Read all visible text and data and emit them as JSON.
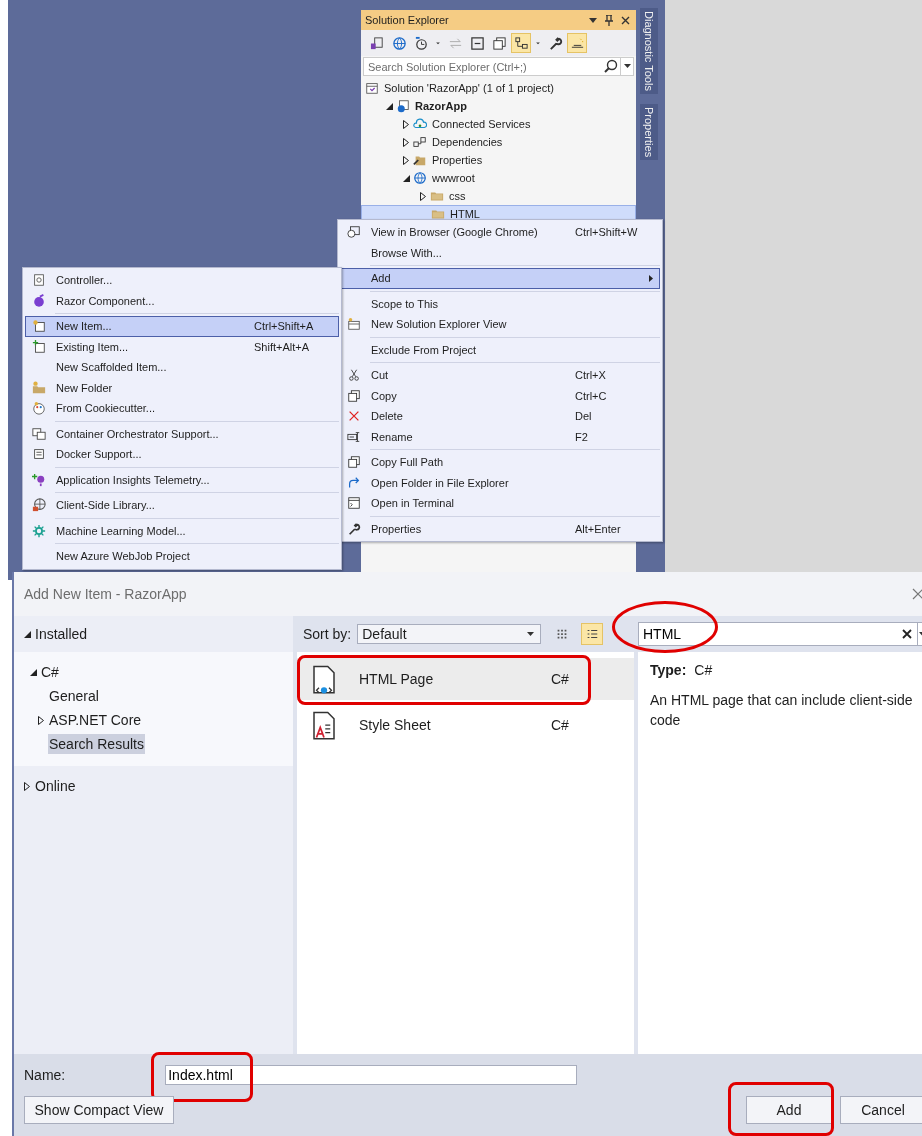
{
  "solution_explorer": {
    "title": "Solution Explorer",
    "toolbar": [
      {
        "kind": "switch-views",
        "selected": false
      },
      {
        "kind": "globe",
        "selected": false
      },
      {
        "kind": "history",
        "selected": false
      },
      {
        "kind": "caret",
        "selected": false
      },
      {
        "kind": "sync",
        "selected": false
      },
      {
        "kind": "collapse",
        "selected": false
      },
      {
        "kind": "copy",
        "selected": false
      },
      {
        "kind": "hierarchy",
        "selected": true
      },
      {
        "kind": "caret",
        "selected": false
      },
      {
        "kind": "wrench",
        "selected": false
      },
      {
        "kind": "preview",
        "selected": true
      }
    ],
    "search": {
      "placeholder": "Search Solution Explorer (Ctrl+;)"
    },
    "tree": [
      {
        "label": "Solution 'RazorApp' (1 of 1 project)",
        "kind": "solution",
        "selected": false,
        "children": [
          {
            "label": "RazorApp",
            "kind": "project",
            "bold": true,
            "expanded": true,
            "selected": false,
            "children": [
              {
                "label": "Connected Services",
                "kind": "service",
                "expanded": false,
                "selected": false
              },
              {
                "label": "Dependencies",
                "kind": "dependencies",
                "expanded": false,
                "selected": false
              },
              {
                "label": "Properties",
                "kind": "properties",
                "expanded": false,
                "selected": false
              },
              {
                "label": "wwwroot",
                "kind": "globe",
                "expanded": true,
                "selected": false,
                "children": [
                  {
                    "label": "css",
                    "kind": "folder",
                    "expanded": false,
                    "selected": false
                  },
                  {
                    "label": "HTML",
                    "kind": "folder",
                    "selected": true
                  }
                ]
              }
            ]
          }
        ]
      }
    ]
  },
  "side_tabs": [
    "Diagnostic Tools",
    "Properties"
  ],
  "context_menu": {
    "groups": [
      [
        {
          "label": "View in Browser (Google Chrome)",
          "shortcut": "Ctrl+Shift+W",
          "kind": "browser",
          "selected": false
        },
        {
          "label": "Browse With...",
          "kind": "plain",
          "selected": false
        }
      ],
      [
        {
          "label": "Add",
          "kind": "plain",
          "submenu": true,
          "selected": true
        }
      ],
      [
        {
          "label": "Scope to This",
          "kind": "plain",
          "selected": false
        },
        {
          "label": "New Solution Explorer View",
          "kind": "new-window",
          "selected": false
        }
      ],
      [
        {
          "label": "Exclude From Project",
          "kind": "plain",
          "selected": false
        }
      ],
      [
        {
          "label": "Cut",
          "shortcut": "Ctrl+X",
          "kind": "cut",
          "selected": false
        },
        {
          "label": "Copy",
          "shortcut": "Ctrl+C",
          "kind": "copy",
          "selected": false
        },
        {
          "label": "Delete",
          "shortcut": "Del",
          "kind": "delete",
          "selected": false
        },
        {
          "label": "Rename",
          "shortcut": "F2",
          "kind": "rename",
          "selected": false
        }
      ],
      [
        {
          "label": "Copy Full Path",
          "kind": "copy",
          "selected": false
        },
        {
          "label": "Open Folder in File Explorer",
          "kind": "redo",
          "selected": false
        },
        {
          "label": "Open in Terminal",
          "kind": "terminal",
          "selected": false
        }
      ],
      [
        {
          "label": "Properties",
          "shortcut": "Alt+Enter",
          "kind": "wrench",
          "selected": false
        }
      ]
    ]
  },
  "add_submenu": {
    "groups": [
      [
        {
          "label": "Controller...",
          "kind": "controller",
          "selected": false
        },
        {
          "label": "Razor Component...",
          "kind": "razor",
          "selected": false
        }
      ],
      [
        {
          "label": "New Item...",
          "shortcut": "Ctrl+Shift+A",
          "kind": "new-item",
          "selected": true
        },
        {
          "label": "Existing Item...",
          "shortcut": "Shift+Alt+A",
          "kind": "existing-item",
          "selected": false
        },
        {
          "label": "New Scaffolded Item...",
          "kind": "plain",
          "selected": false
        },
        {
          "label": "New Folder",
          "kind": "new-folder",
          "selected": false
        },
        {
          "label": "From Cookiecutter...",
          "kind": "palette",
          "selected": false
        }
      ],
      [
        {
          "label": "Container Orchestrator Support...",
          "kind": "containers",
          "selected": false
        },
        {
          "label": "Docker Support...",
          "kind": "container",
          "selected": false
        }
      ],
      [
        {
          "label": "Application Insights Telemetry...",
          "kind": "bulb",
          "selected": false
        }
      ],
      [
        {
          "label": "Client-Side Library...",
          "kind": "globe-lib",
          "selected": false
        }
      ],
      [
        {
          "label": "Machine Learning Model...",
          "kind": "gear",
          "selected": false
        }
      ],
      [
        {
          "label": "New Azure WebJob Project",
          "kind": "plain",
          "selected": false
        }
      ]
    ]
  },
  "dialog": {
    "title": "Add New Item - RazorApp",
    "categories": [
      {
        "label": "Installed",
        "expanded": true,
        "selected": false,
        "children": [
          {
            "label": "C#",
            "expanded": true,
            "selected": false,
            "children": [
              {
                "label": "General",
                "selected": false
              },
              {
                "label": "ASP.NET Core",
                "expanded": false,
                "selected": false
              },
              {
                "label": "Search Results",
                "selected": true
              }
            ]
          }
        ]
      },
      {
        "label": "Online",
        "expanded": false,
        "selected": false
      }
    ],
    "sort_label": "Sort by:",
    "sort_value": "Default",
    "view_modes": [
      {
        "kind": "grid",
        "selected": false
      },
      {
        "kind": "list",
        "selected": true
      }
    ],
    "search": {
      "value": "HTML",
      "annotated": true
    },
    "templates": [
      {
        "name": "HTML Page",
        "language": "C#",
        "kind": "html",
        "selected": true,
        "annotated": true
      },
      {
        "name": "Style Sheet",
        "language": "C#",
        "kind": "css",
        "selected": false,
        "annotated": false
      }
    ],
    "details": {
      "type_label": "Type:",
      "type_value": "C#",
      "description": "An HTML page that can include client-side code"
    },
    "name_label": "Name:",
    "name_value": "Index.html",
    "name_annotated": true,
    "buttons": [
      {
        "label": "Show Compact View",
        "kind": "left",
        "annotated": false
      },
      {
        "label": "Add",
        "kind": "right",
        "annotated": true
      },
      {
        "label": "Cancel",
        "kind": "right",
        "annotated": false
      }
    ]
  }
}
